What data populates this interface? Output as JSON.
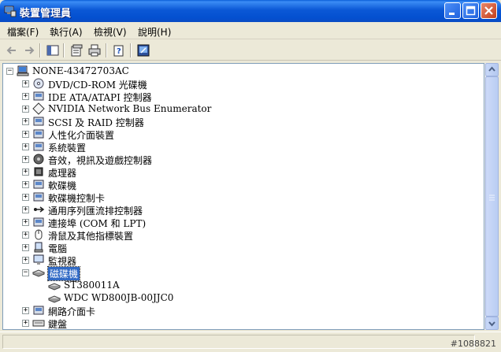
{
  "window": {
    "title": "裝置管理員"
  },
  "menu": [
    {
      "label": "檔案(F)"
    },
    {
      "label": "執行(A)"
    },
    {
      "label": "檢視(V)"
    },
    {
      "label": "說明(H)"
    }
  ],
  "tree": {
    "root": "NONE-43472703AC",
    "items": [
      {
        "label": "DVD/CD-ROM 光碟機",
        "expander": "+",
        "icon": "dvd-drive-icon"
      },
      {
        "label": "IDE ATA/ATAPI 控制器",
        "expander": "+",
        "icon": "ide-controller-icon"
      },
      {
        "label": "NVIDIA Network Bus Enumerator",
        "expander": "+",
        "icon": "network-bus-icon"
      },
      {
        "label": "SCSI 及 RAID 控制器",
        "expander": "+",
        "icon": "scsi-controller-icon"
      },
      {
        "label": "人性化介面裝置",
        "expander": "+",
        "icon": "hid-icon"
      },
      {
        "label": "系統裝置",
        "expander": "+",
        "icon": "system-device-icon"
      },
      {
        "label": "音效，視訊及遊戲控制器",
        "expander": "+",
        "icon": "audio-icon"
      },
      {
        "label": "處理器",
        "expander": "+",
        "icon": "processor-icon"
      },
      {
        "label": "軟碟機",
        "expander": "+",
        "icon": "floppy-drive-icon"
      },
      {
        "label": "軟碟機控制卡",
        "expander": "+",
        "icon": "floppy-controller-icon"
      },
      {
        "label": "通用序列匯流排控制器",
        "expander": "+",
        "icon": "usb-controller-icon"
      },
      {
        "label": "連接埠 (COM 和 LPT)",
        "expander": "+",
        "icon": "port-icon"
      },
      {
        "label": "滑鼠及其他指標裝置",
        "expander": "+",
        "icon": "mouse-icon"
      },
      {
        "label": "電腦",
        "expander": "+",
        "icon": "computer-icon"
      },
      {
        "label": "監視器",
        "expander": "+",
        "icon": "monitor-icon"
      },
      {
        "label": "磁碟機",
        "expander": "-",
        "icon": "disk-drive-icon",
        "selected": true
      },
      {
        "label": "ST380011A",
        "child": true,
        "icon": "disk-icon"
      },
      {
        "label": "WDC WD800JB-00JJC0",
        "child": true,
        "icon": "disk-icon"
      },
      {
        "label": "網路介面卡",
        "expander": "+",
        "icon": "network-adapter-icon"
      },
      {
        "label": "鍵盤",
        "expander": "+",
        "icon": "keyboard-icon"
      }
    ]
  },
  "status": {
    "watermark": "#1088821"
  },
  "colors": {
    "selection": "#316ac5",
    "titlebar": "#0a58d6"
  }
}
